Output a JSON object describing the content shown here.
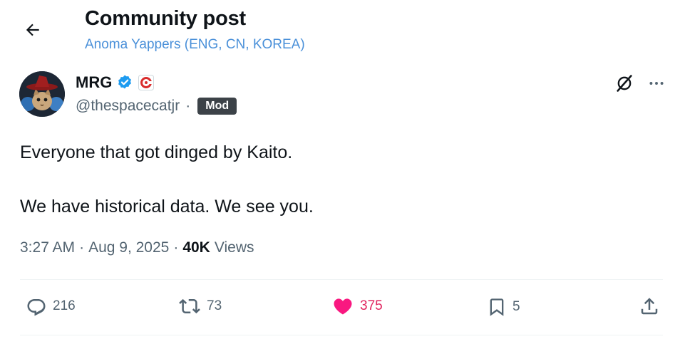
{
  "header": {
    "title": "Community post",
    "community": "Anoma Yappers (ENG, CN, KOREA)"
  },
  "author": {
    "name": "MRG",
    "handle": "@thespacecatjr",
    "separator": "·",
    "badge": "Mod",
    "verified_color": "#1d9bf0"
  },
  "post": {
    "line1": "Everyone that got dinged by Kaito.",
    "line2": "We have historical data. We see you.",
    "time": "3:27 AM",
    "date": "Aug 9, 2025",
    "views_count": "40K",
    "views_label": "Views",
    "dot": "·"
  },
  "actions": {
    "replies": "216",
    "reposts": "73",
    "likes": "375",
    "bookmarks": "5"
  },
  "colors": {
    "accent_blue": "#4a90d9",
    "like_pink": "#e0245e",
    "muted": "#536471"
  }
}
